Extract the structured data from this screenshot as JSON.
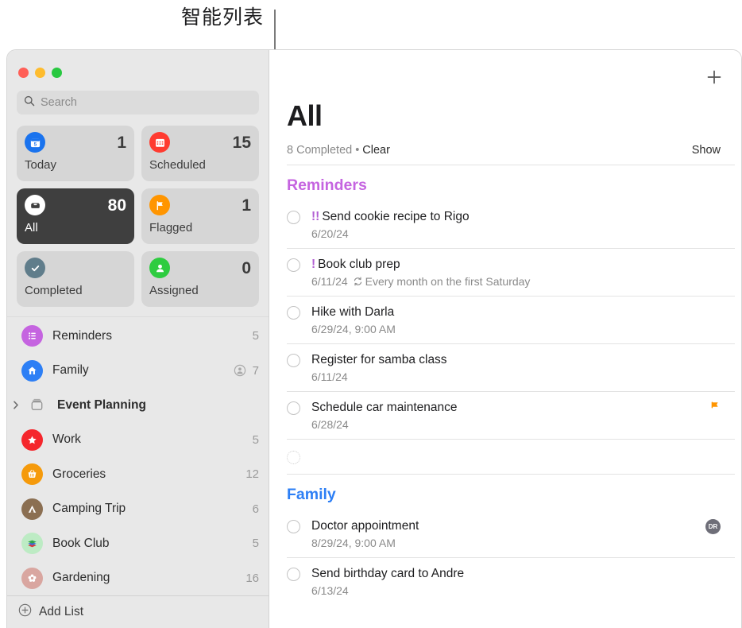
{
  "annotation": {
    "label": "智能列表"
  },
  "window": {
    "traffic_lights": [
      "close",
      "minimize",
      "zoom"
    ],
    "search": {
      "placeholder": "Search",
      "value": "",
      "icon": "search-icon"
    }
  },
  "smart_lists": [
    {
      "label": "Today",
      "count": "1",
      "icon": "calendar-icon",
      "color": "#1a73ee",
      "active": false
    },
    {
      "label": "Scheduled",
      "count": "15",
      "icon": "calendar-grid-icon",
      "color": "#ff3b30",
      "active": false
    },
    {
      "label": "All",
      "count": "80",
      "icon": "inbox-icon",
      "color": "#ffffff",
      "active": true
    },
    {
      "label": "Flagged",
      "count": "1",
      "icon": "flag-icon",
      "color": "#ff9500",
      "active": false
    },
    {
      "label": "Completed",
      "count": "",
      "icon": "check-icon",
      "color": "#607d8b",
      "active": false
    },
    {
      "label": "Assigned",
      "count": "0",
      "icon": "person-icon",
      "color": "#2ecc40",
      "active": false
    }
  ],
  "my_lists": [
    {
      "name": "Reminders",
      "count": "5",
      "icon": "list-icon",
      "color": "#c564e0",
      "shared": false,
      "group": false
    },
    {
      "name": "Family",
      "count": "7",
      "icon": "house-icon",
      "color": "#2d7ff5",
      "shared": true,
      "group": false
    },
    {
      "name": "Event Planning",
      "count": "",
      "icon": "folder-icon",
      "color": "",
      "shared": false,
      "group": true
    },
    {
      "name": "Work",
      "count": "5",
      "icon": "star-icon",
      "color": "#f5262c",
      "shared": false,
      "group": false
    },
    {
      "name": "Groceries",
      "count": "12",
      "icon": "basket-icon",
      "color": "#f59a0b",
      "shared": false,
      "group": false
    },
    {
      "name": "Camping Trip",
      "count": "6",
      "icon": "tent-icon",
      "color": "#8b6f52",
      "shared": false,
      "group": false
    },
    {
      "name": "Book Club",
      "count": "5",
      "icon": "books-icon",
      "color": "#bdebc4",
      "shared": false,
      "group": false
    },
    {
      "name": "Gardening",
      "count": "16",
      "icon": "flower-icon",
      "color": "#d9a6a0",
      "shared": false,
      "group": false
    }
  ],
  "add_list": {
    "label": "Add List",
    "icon": "plus-circle-icon"
  },
  "main": {
    "add_button_icon": "plus-icon",
    "title": "All",
    "completed_text": "8 Completed",
    "separator": "•",
    "clear_label": "Clear",
    "show_label": "Show",
    "sections": [
      {
        "name": "Reminders",
        "color": "#c564e0",
        "items": [
          {
            "priority": "!!",
            "title": "Send cookie recipe to Rigo",
            "meta": "6/20/24",
            "repeat": "",
            "flag": false,
            "avatar": ""
          },
          {
            "priority": "!",
            "title": "Book club prep",
            "meta": "6/11/24",
            "repeat": "Every month on the first Saturday",
            "flag": false,
            "avatar": ""
          },
          {
            "priority": "",
            "title": "Hike with Darla",
            "meta": "6/29/24, 9:00 AM",
            "repeat": "",
            "flag": false,
            "avatar": ""
          },
          {
            "priority": "",
            "title": "Register for samba class",
            "meta": "6/11/24",
            "repeat": "",
            "flag": false,
            "avatar": ""
          },
          {
            "priority": "",
            "title": "Schedule car maintenance",
            "meta": "6/28/24",
            "repeat": "",
            "flag": true,
            "avatar": ""
          },
          {
            "priority": "",
            "title": "",
            "meta": "",
            "repeat": "",
            "flag": false,
            "avatar": "",
            "empty": true
          }
        ]
      },
      {
        "name": "Family",
        "color": "#2d7ff5",
        "items": [
          {
            "priority": "",
            "title": "Doctor appointment",
            "meta": "8/29/24, 9:00 AM",
            "repeat": "",
            "flag": false,
            "avatar": "DR"
          },
          {
            "priority": "",
            "title": "Send birthday card to Andre",
            "meta": "6/13/24",
            "repeat": "",
            "flag": false,
            "avatar": ""
          }
        ]
      }
    ]
  }
}
